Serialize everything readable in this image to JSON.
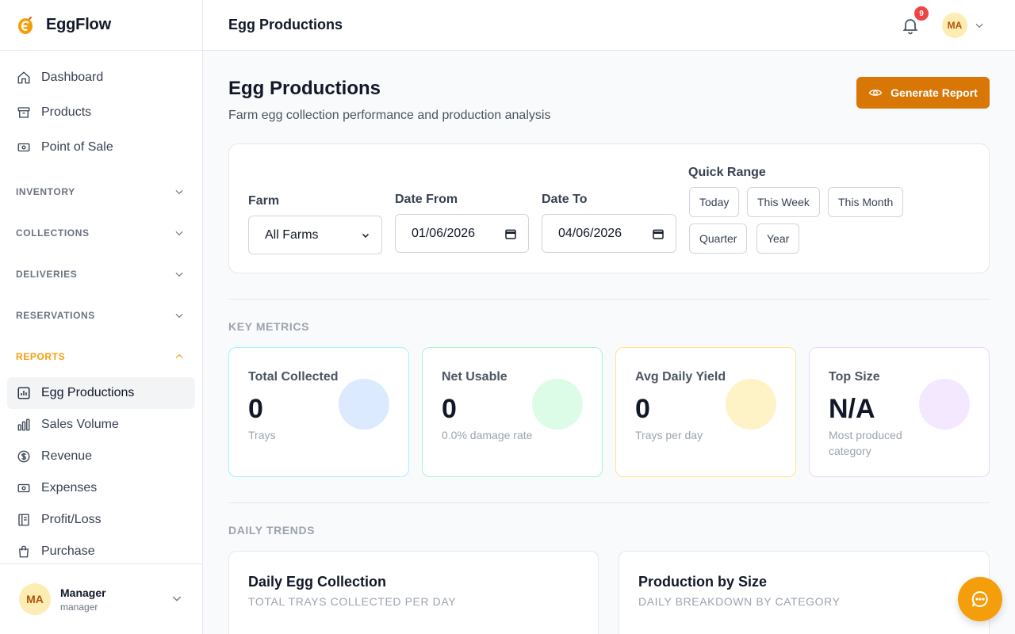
{
  "app": {
    "name": "EggFlow"
  },
  "sidebar": {
    "top_items": [
      {
        "label": "Dashboard",
        "icon": "home-icon"
      },
      {
        "label": "Products",
        "icon": "archive-box-icon"
      },
      {
        "label": "Point of Sale",
        "icon": "cash-register-icon"
      }
    ],
    "sections": [
      {
        "label": "INVENTORY",
        "expanded": false
      },
      {
        "label": "COLLECTIONS",
        "expanded": false
      },
      {
        "label": "DELIVERIES",
        "expanded": false
      },
      {
        "label": "RESERVATIONS",
        "expanded": false
      },
      {
        "label": "REPORTS",
        "expanded": true
      }
    ],
    "report_items": [
      {
        "label": "Egg Productions",
        "icon": "bar-chart-icon",
        "active": true
      },
      {
        "label": "Sales Volume",
        "icon": "bar-chart-alt-icon"
      },
      {
        "label": "Revenue",
        "icon": "dollar-circle-icon"
      },
      {
        "label": "Expenses",
        "icon": "banknote-icon"
      },
      {
        "label": "Profit/Loss",
        "icon": "ledger-icon"
      },
      {
        "label": "Purchase",
        "icon": "shopping-bag-icon"
      }
    ],
    "user": {
      "initials": "MA",
      "name": "Manager",
      "role": "manager"
    }
  },
  "topbar": {
    "title": "Egg Productions",
    "notification_count": "9",
    "avatar_initials": "MA"
  },
  "page": {
    "title": "Egg Productions",
    "subtitle": "Farm egg collection performance and production analysis",
    "generate_button": "Generate Report"
  },
  "filters": {
    "farm_label": "Farm",
    "farm_value": "All Farms",
    "date_from_label": "Date From",
    "date_from_value": "01/06/2026",
    "date_to_label": "Date To",
    "date_to_value": "04/06/2026",
    "quick_range_label": "Quick Range",
    "quick_ranges": [
      "Today",
      "This Week",
      "This Month",
      "Quarter",
      "Year"
    ]
  },
  "key_metrics": {
    "title": "KEY METRICS",
    "cards": [
      {
        "label": "Total Collected",
        "value": "0",
        "desc": "Trays",
        "border": "#a5f3fc",
        "blob": "#dbeafe"
      },
      {
        "label": "Net Usable",
        "value": "0",
        "desc": "0.0% damage rate",
        "border": "#a7f3d0",
        "blob": "#dcfce7"
      },
      {
        "label": "Avg Daily Yield",
        "value": "0",
        "desc": "Trays per day",
        "border": "#fde68a",
        "blob": "#fef3c7"
      },
      {
        "label": "Top Size",
        "value": "N/A",
        "desc": "Most produced category",
        "border": "#e9d5ff",
        "blob": "#f3e8ff"
      }
    ]
  },
  "daily_trends": {
    "title": "DAILY TRENDS",
    "charts": [
      {
        "title": "Daily Egg Collection",
        "subtitle": "TOTAL TRAYS COLLECTED PER DAY"
      },
      {
        "title": "Production by Size",
        "subtitle": "DAILY BREAKDOWN BY CATEGORY"
      }
    ]
  },
  "colors": {
    "accent": "#d97706",
    "accent_light": "#f59e0b",
    "badge": "#ef4444"
  }
}
